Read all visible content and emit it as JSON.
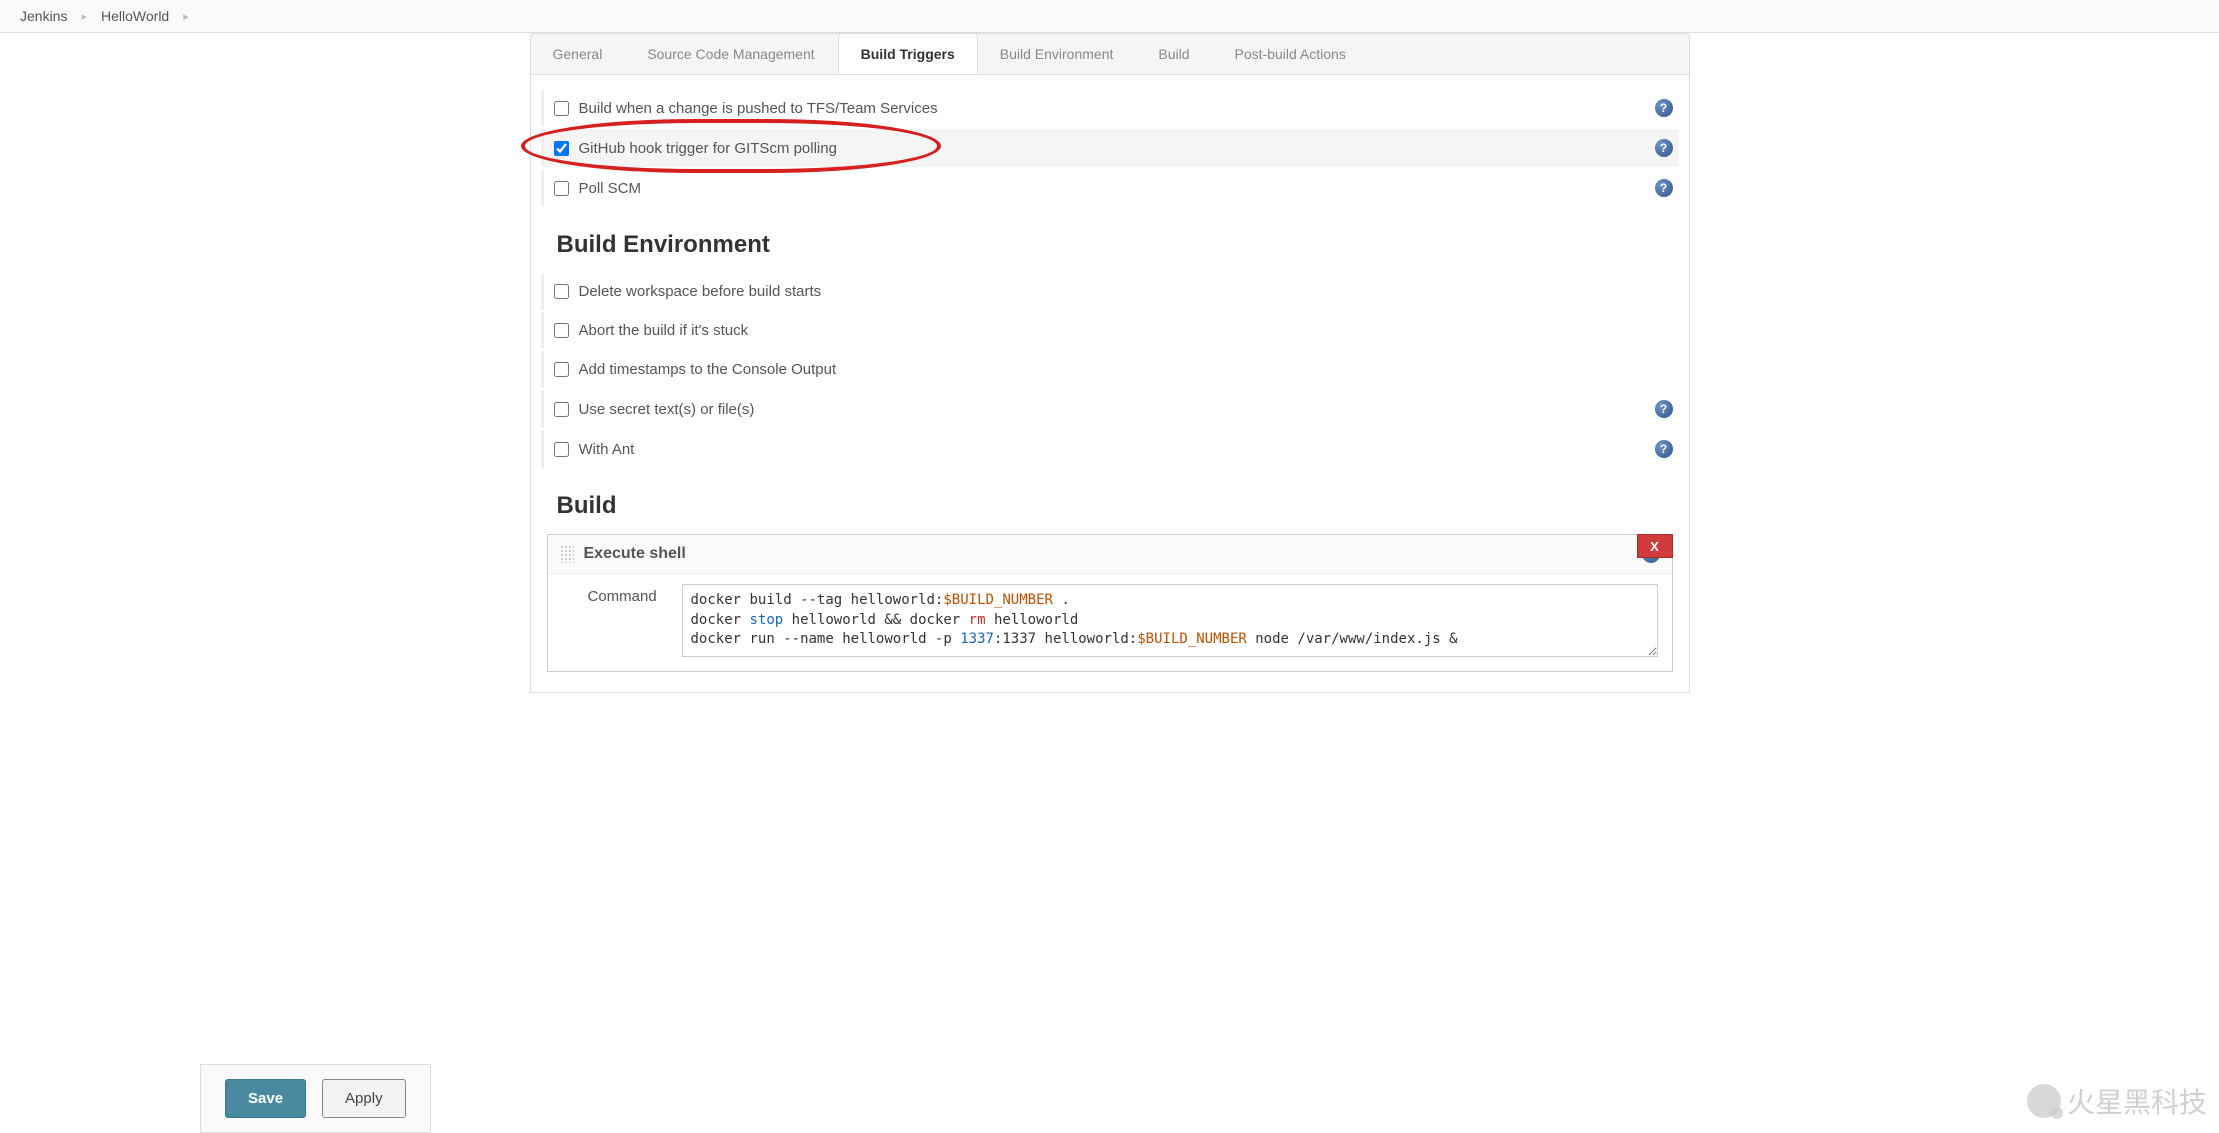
{
  "breadcrumb": {
    "root": "Jenkins",
    "job": "HelloWorld"
  },
  "tabs": [
    {
      "label": "General",
      "active": false
    },
    {
      "label": "Source Code Management",
      "active": false
    },
    {
      "label": "Build Triggers",
      "active": true
    },
    {
      "label": "Build Environment",
      "active": false
    },
    {
      "label": "Build",
      "active": false
    },
    {
      "label": "Post-build Actions",
      "active": false
    }
  ],
  "triggers": [
    {
      "label": "Build when a change is pushed to TFS/Team Services",
      "checked": false,
      "help": true
    },
    {
      "label": "GitHub hook trigger for GITScm polling",
      "checked": true,
      "help": true,
      "highlight": true
    },
    {
      "label": "Poll SCM",
      "checked": false,
      "help": true
    }
  ],
  "sections": {
    "build_env": "Build Environment",
    "build": "Build"
  },
  "build_env": [
    {
      "label": "Delete workspace before build starts",
      "checked": false,
      "help": false
    },
    {
      "label": "Abort the build if it's stuck",
      "checked": false,
      "help": false
    },
    {
      "label": "Add timestamps to the Console Output",
      "checked": false,
      "help": false
    },
    {
      "label": "Use secret text(s) or file(s)",
      "checked": false,
      "help": true
    },
    {
      "label": "With Ant",
      "checked": false,
      "help": true
    }
  ],
  "build_step": {
    "title": "Execute shell",
    "command_label": "Command",
    "command": "docker build --tag helloworld:$BUILD_NUMBER .\ndocker stop helloworld && docker rm helloworld\ndocker run --name helloworld -p 1337:1337 helloworld:$BUILD_NUMBER node /var/www/index.js &",
    "close": "X"
  },
  "buttons": {
    "save": "Save",
    "apply": "Apply"
  },
  "watermark": "火星黑科技"
}
